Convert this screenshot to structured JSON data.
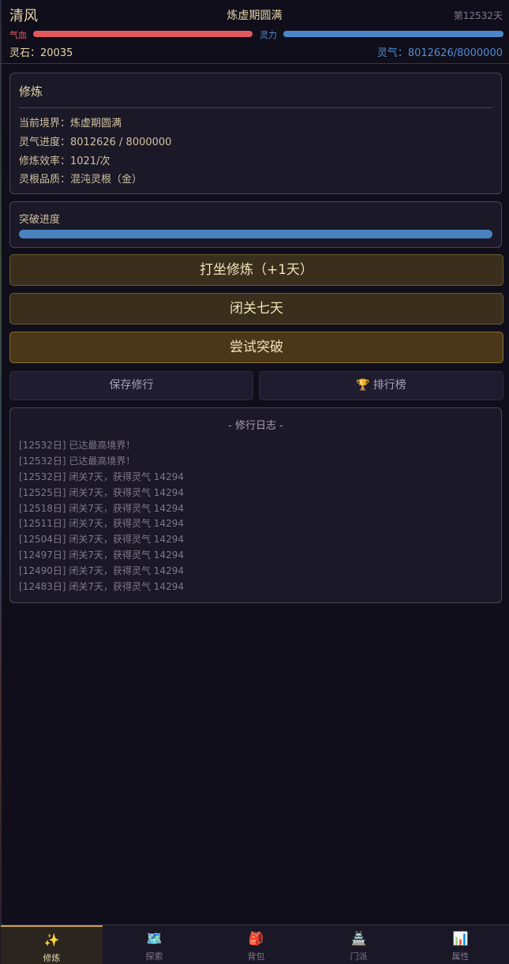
{
  "header": {
    "player_name": "清风",
    "realm": "炼虚期圆满",
    "day": "第12532天",
    "hp_label": "气血",
    "mp_label": "灵力",
    "hp_fraction": 1.0,
    "mp_fraction": 1.0,
    "stones": "灵石：20035",
    "qi": "灵气：8012626/8000000"
  },
  "cultivation": {
    "title": "修炼",
    "realm_row": "当前境界：炼虚期圆满",
    "progress_row": "灵气进度：8012626 / 8000000",
    "efficiency_row": "修炼效率：1021/次",
    "root_row": "灵根品质：混沌灵根（金）"
  },
  "breakthrough": {
    "title": "突破进度",
    "progress_fraction": 1.0
  },
  "actions": {
    "meditate": "打坐修炼（+1天）",
    "seclude": "闭关七天",
    "breakthrough": "尝试突破",
    "save": "保存修行",
    "leaderboard": "排行榜"
  },
  "log": {
    "title": "- 修行日志 -",
    "entries": [
      "[12532日] 已达最高境界！",
      "[12532日] 已达最高境界！",
      "[12532日] 闭关7天，获得灵气 14294",
      "[12525日] 闭关7天，获得灵气 14294",
      "[12518日] 闭关7天，获得灵气 14294",
      "[12511日] 闭关7天，获得灵气 14294",
      "[12504日] 闭关7天，获得灵气 14294",
      "[12497日] 闭关7天，获得灵气 14294",
      "[12490日] 闭关7天，获得灵气 14294",
      "[12483日] 闭关7天，获得灵气 14294"
    ]
  },
  "nav": [
    {
      "label": "修炼",
      "icon": "sparkles-icon",
      "active": true
    },
    {
      "label": "探索",
      "icon": "map-icon",
      "active": false
    },
    {
      "label": "背包",
      "icon": "backpack-icon",
      "active": false
    },
    {
      "label": "门派",
      "icon": "temple-icon",
      "active": false
    },
    {
      "label": "属性",
      "icon": "bar-chart-icon",
      "active": false
    }
  ],
  "colors": {
    "hp": "#e05a5f",
    "mp": "#4a86c8",
    "gold_text": "#e6d6a8",
    "background": "#100e1a"
  }
}
